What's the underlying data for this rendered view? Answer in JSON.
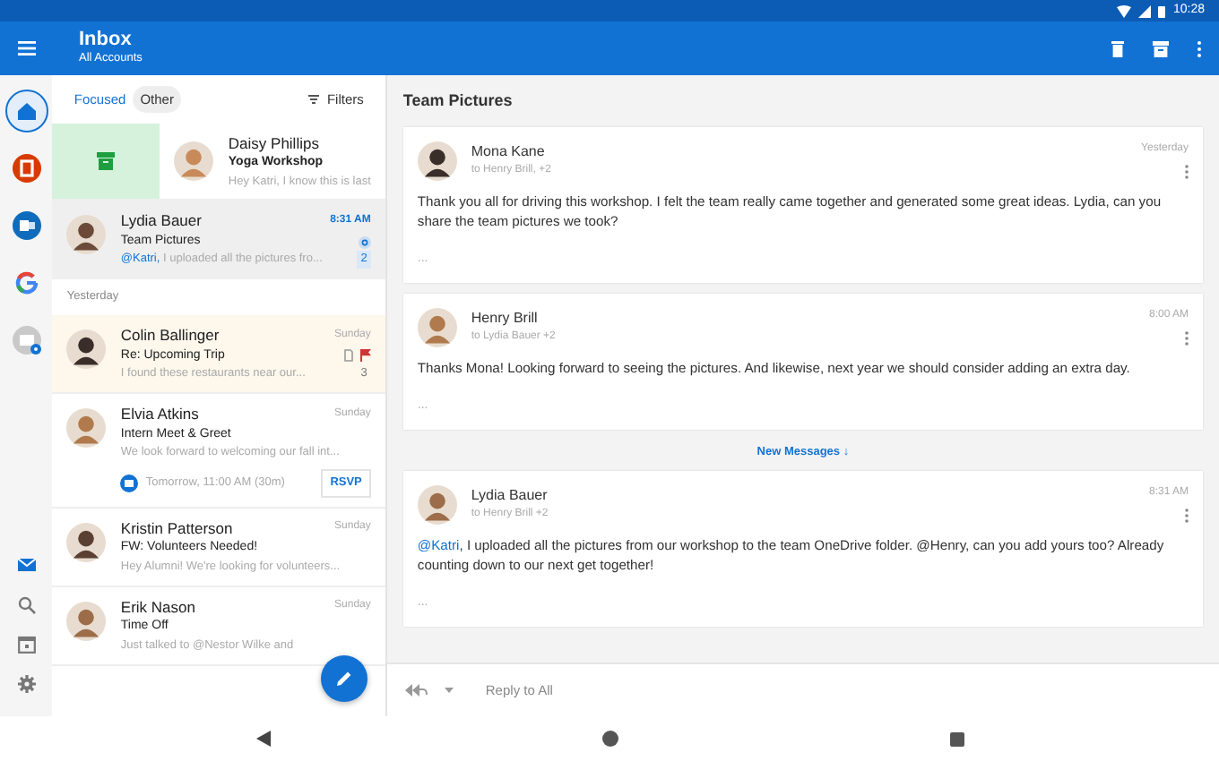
{
  "status_bar": {
    "time": "10:28"
  },
  "app_bar": {
    "title": "Inbox",
    "subtitle": "All Accounts"
  },
  "rail": {
    "accounts": [
      {
        "kind": "home",
        "selected": true
      },
      {
        "kind": "office",
        "selected": false
      },
      {
        "kind": "outlook",
        "selected": false
      },
      {
        "kind": "google",
        "selected": false
      },
      {
        "kind": "add",
        "selected": false
      }
    ],
    "tools": [
      {
        "kind": "mail",
        "selected": true
      },
      {
        "kind": "search",
        "selected": false
      },
      {
        "kind": "calendar",
        "selected": false
      },
      {
        "kind": "settings",
        "selected": false
      }
    ]
  },
  "list_tabs": [
    {
      "label": "Focused",
      "selected": true
    },
    {
      "label": "Other",
      "selected": false
    }
  ],
  "filters": "Filters",
  "messages": [
    {
      "kind": "swiped",
      "sender": "Daisy Phillips",
      "subject": "Yoga Workshop",
      "preview": "Hey Katri, I know this is last"
    },
    {
      "kind": "mail",
      "sender": "Lydia Bauer",
      "time": "8:31 AM",
      "subject": "Team Pictures",
      "mention": "@Katri,",
      "preview": " I uploaded all the pictures fro...",
      "selected": true,
      "unread": true,
      "mentioned": true,
      "attachment": false,
      "flagged": false,
      "count": "2"
    },
    {
      "kind": "header",
      "label": "Yesterday"
    },
    {
      "kind": "mail",
      "sender": "Colin Ballinger",
      "time": "Sunday",
      "subject": "Re: Upcoming Trip",
      "preview": "I found these restaurants near our...",
      "selected": false,
      "unread": false,
      "mentioned": false,
      "attachment": true,
      "flagged": true,
      "count": "3"
    },
    {
      "kind": "mail",
      "sender": "Elvia Atkins",
      "time": "Sunday",
      "subject": "Intern Meet & Greet",
      "preview": "We look forward to welcoming our fall int...",
      "selected": false,
      "unread": false,
      "mentioned": false,
      "attachment": false,
      "flagged": false,
      "event": {
        "text": "Tomorrow, 11:00 AM (30m)",
        "action": "RSVP"
      }
    },
    {
      "kind": "mail",
      "sender": "Kristin Patterson",
      "time": "Sunday",
      "subject": "FW: Volunteers Needed!",
      "preview": "Hey Alumni! We're looking for volunteers...",
      "selected": false,
      "unread": false,
      "mentioned": false,
      "attachment": false,
      "flagged": false
    },
    {
      "kind": "mail",
      "sender": "Erik Nason",
      "time": "Sunday",
      "subject": "Time Off",
      "preview": "Just talked to @Nestor Wilke and",
      "selected": false,
      "unread": false,
      "mentioned": false,
      "attachment": false,
      "flagged": false
    }
  ],
  "thread": {
    "title": "Team Pictures",
    "items": [
      {
        "kind": "message",
        "sender": "Mona Kane",
        "recipients": "to Henry Brill, +2",
        "time": "Yesterday",
        "body": "Thank you all for driving this workshop. I felt the team really came together and generated some great ideas. Lydia, can you share the team pictures we took?",
        "more": "..."
      },
      {
        "kind": "message",
        "sender": "Henry Brill",
        "recipients": "to Lydia Bauer +2",
        "time": "8:00 AM",
        "body": "Thanks Mona! Looking forward to seeing the pictures. And likewise, next year we should consider adding an extra day.",
        "more": "..."
      },
      {
        "kind": "divider",
        "label": "New Messages ↓"
      },
      {
        "kind": "message",
        "sender": "Lydia Bauer",
        "recipients": "to Henry Brill +2",
        "time": "8:31 AM",
        "mention": "@Katri",
        "body": ", I uploaded all the pictures from our workshop to the team OneDrive folder. @Henry, can you add yours too? Already counting down to our next get together!",
        "more": "..."
      }
    ]
  },
  "reply": {
    "placeholder": "Reply to All"
  }
}
